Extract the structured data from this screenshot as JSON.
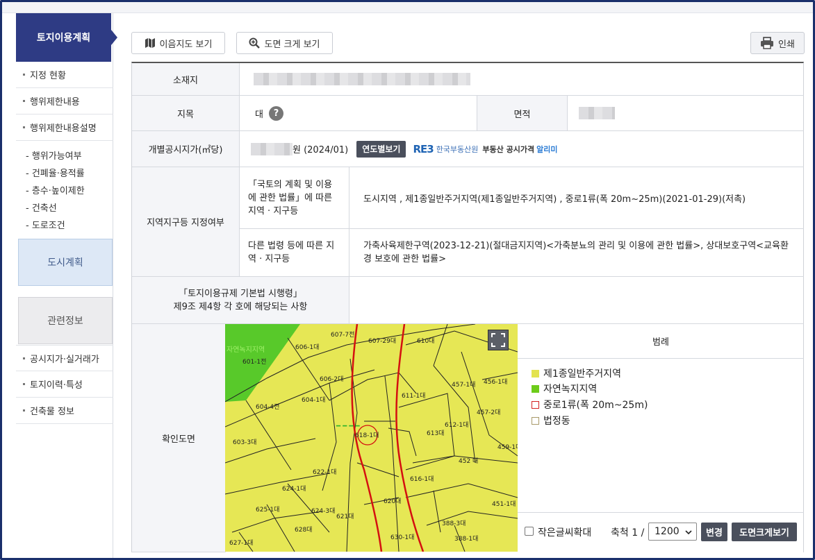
{
  "sidebar": {
    "header": "토지이용계획",
    "items": [
      {
        "label": "지정 현황"
      },
      {
        "label": "행위제한내용"
      },
      {
        "label": "행위제한내용설명"
      }
    ],
    "subitems": [
      "- 행위가능여부",
      "- 건폐율·용적률",
      "- 층수·높이제한",
      "- 건축선",
      "- 도로조건"
    ],
    "city_plan": "도시계획",
    "related": "관련정보",
    "related_items": [
      {
        "label": "공시지가·실거래가"
      },
      {
        "label": "토지이력·특성"
      },
      {
        "label": "건축물 정보"
      }
    ]
  },
  "toolbar": {
    "map_view": "이음지도 보기",
    "zoom_view": "도면 크게 보기",
    "print": "인쇄"
  },
  "table": {
    "location_label": "소재지",
    "jimok_label": "지목",
    "jimok_value": "대",
    "help_icon": "?",
    "area_label": "면적",
    "price_label": "개별공시지가(㎡당)",
    "price_suffix": "원 (2024/01)",
    "year_button": "연도별보기",
    "reb_logo": "RE3",
    "reb_name": "한국부동산원",
    "reb_service": "부동산 공시가격",
    "reb_alimi": "알리미",
    "zoning_label": "지역지구등 지정여부",
    "national_law_label": "「국토의 계획 및 이용에 관한 법률」에 따른 지역 · 지구등",
    "national_law_value": "도시지역 , 제1종일반주거지역(제1종일반주거지역) , 중로1류(폭 20m~25m)(2021-01-29)(저촉)",
    "other_law_label": "다른 법령 등에 따른 지역 · 지구등",
    "other_law_value": "가축사육제한구역(2023-12-21)(절대금지지역)<가축분뇨의 관리 및 이용에 관한 법률>, 상대보호구역<교육환경 보호에 관한 법률>",
    "decree_label_1": "「토지이용규제 기본법 시행령」",
    "decree_label_2": "제9조 제4항 각 호에 해당되는 사항",
    "map_label": "확인도면"
  },
  "map": {
    "parcels": [
      "607-7전",
      "607-29대",
      "610대",
      "606-1대",
      "601-1전",
      "606-2대",
      "457-1대",
      "456-1대",
      "604-4전",
      "604-1대",
      "611-1대",
      "457-2대",
      "612-1대",
      "603-3대",
      "618-1대",
      "613대",
      "459-1대",
      "452 대",
      "622-1대",
      "616-1대",
      "624-1대",
      "624-3대",
      "620대",
      "625-1대",
      "621대",
      "451-1대",
      "628대",
      "630-1대",
      "388-3대",
      "627-1대",
      "388-1대"
    ],
    "green_zone_label": "자연녹지지역"
  },
  "legend": {
    "title": "범례",
    "items": [
      {
        "label": "제1종일반주거지역",
        "color": "#e3e350"
      },
      {
        "label": "자연녹지지역",
        "color": "#6dcc1a"
      },
      {
        "label": "중로1류(폭 20m~25m)",
        "color": "#d32020"
      },
      {
        "label": "법정동",
        "color": "#a89968"
      }
    ]
  },
  "controls": {
    "small_text_zoom": "작은글씨확대",
    "scale_label": "축척 1 /",
    "scale_value": "1200",
    "change_button": "변경",
    "map_zoom_button": "도면크게보기"
  }
}
